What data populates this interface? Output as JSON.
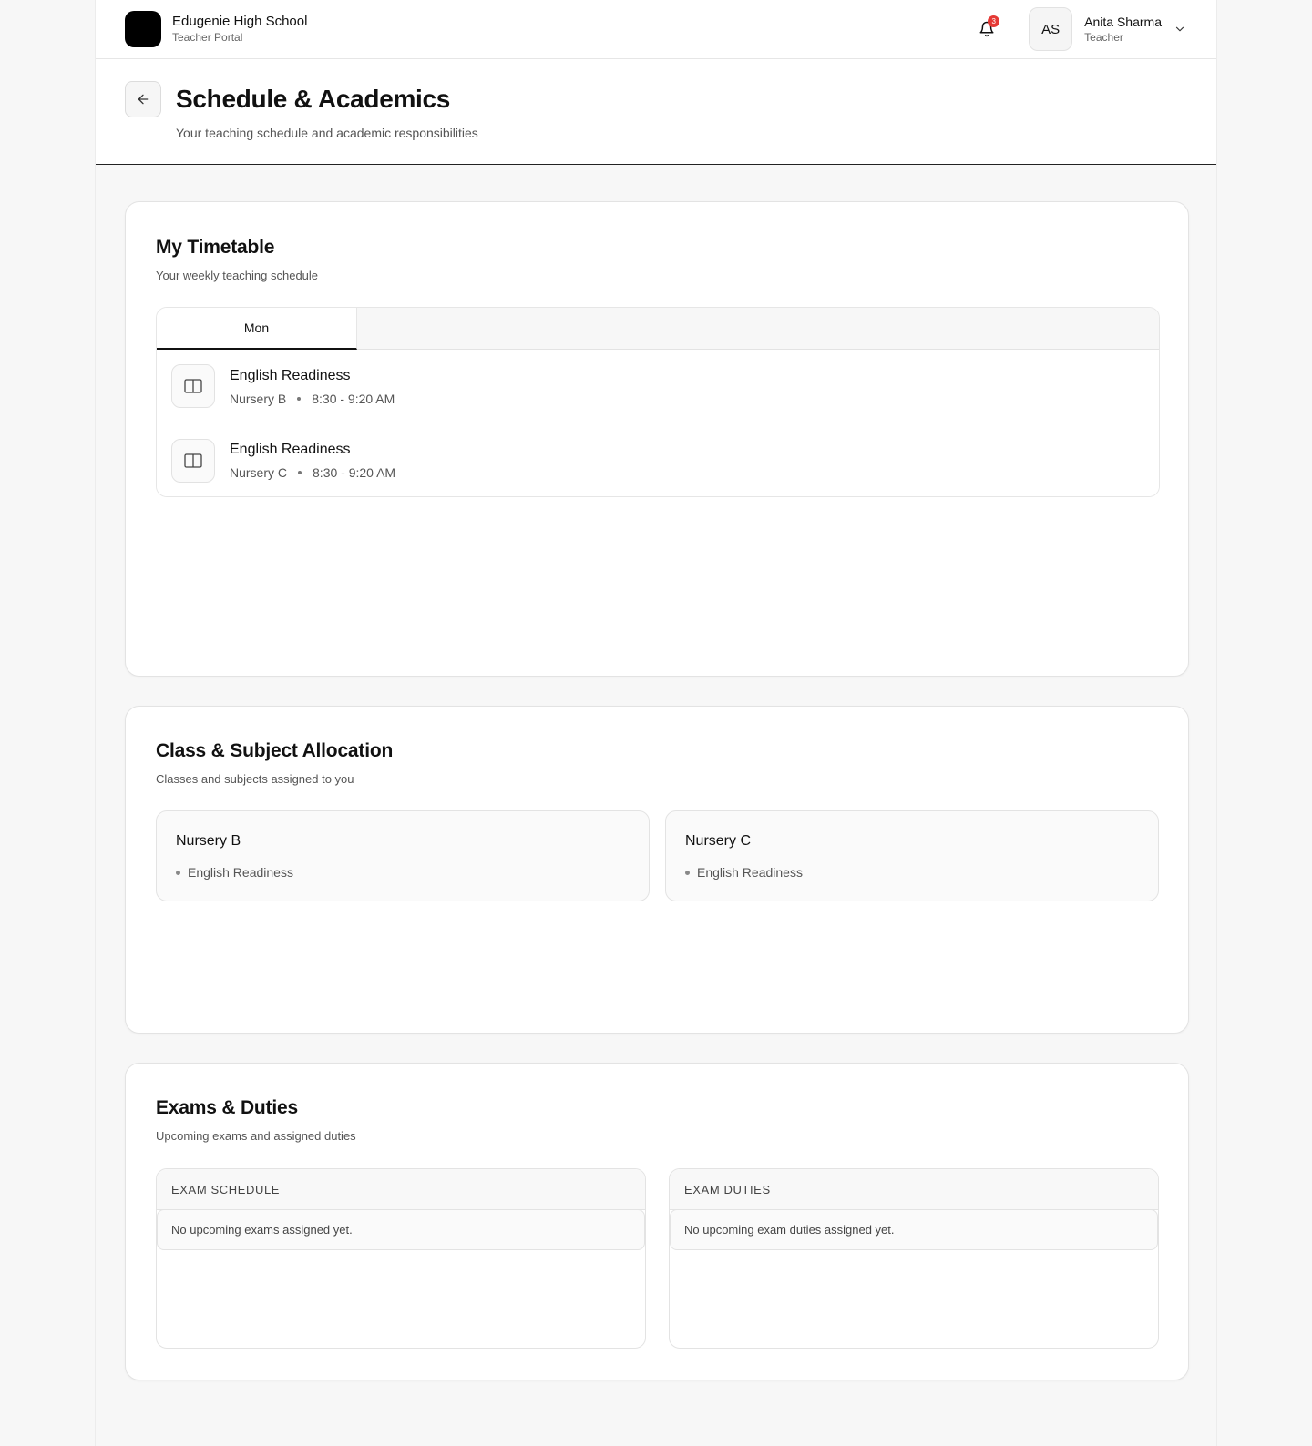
{
  "header": {
    "school_name": "Edugenie High School",
    "portal_name": "Teacher Portal",
    "notification_count": "3",
    "user_initials": "AS",
    "user_name": "Anita Sharma",
    "user_role": "Teacher"
  },
  "page": {
    "title": "Schedule & Academics",
    "subtitle": "Your teaching schedule and academic responsibilities"
  },
  "timetable": {
    "title": "My Timetable",
    "subtitle": "Your weekly teaching schedule",
    "tabs": [
      {
        "label": "Mon"
      }
    ],
    "slots": [
      {
        "subject": "English Readiness",
        "class": "Nursery B",
        "time": "8:30 - 9:20 AM"
      },
      {
        "subject": "English Readiness",
        "class": "Nursery C",
        "time": "8:30 - 9:20 AM"
      }
    ]
  },
  "allocation": {
    "title": "Class & Subject Allocation",
    "subtitle": "Classes and subjects assigned to you",
    "classes": [
      {
        "class": "Nursery B",
        "subjects": [
          "English Readiness"
        ]
      },
      {
        "class": "Nursery C",
        "subjects": [
          "English Readiness"
        ]
      }
    ]
  },
  "exams": {
    "title": "Exams & Duties",
    "subtitle": "Upcoming exams and assigned duties",
    "schedule": {
      "heading": "EXAM SCHEDULE",
      "empty": "No upcoming exams assigned yet."
    },
    "duties": {
      "heading": "EXAM DUTIES",
      "empty": "No upcoming exam duties assigned yet."
    }
  },
  "colors": {
    "badge": "#e53935",
    "text": "#111111",
    "accent": "#000000"
  },
  "icons": {
    "bell": "bell-icon",
    "back": "arrow-left-icon",
    "chevron": "chevron-down-icon",
    "slot": "book-icon"
  }
}
